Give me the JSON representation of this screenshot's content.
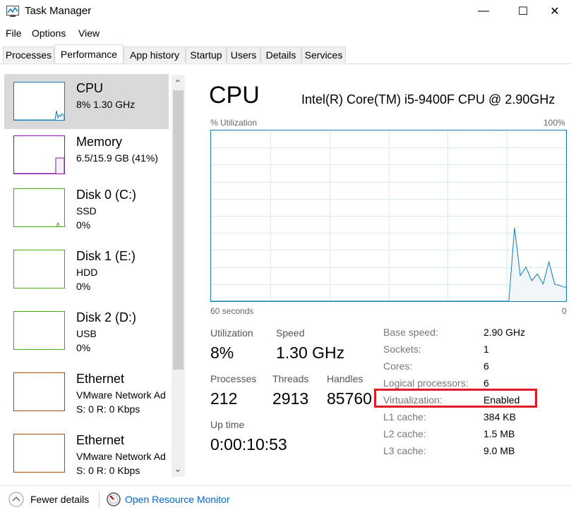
{
  "window": {
    "title": "Task Manager",
    "minimize_glyph": "—",
    "maximize_glyph": "☐",
    "close_glyph": "✕"
  },
  "menu": {
    "file": "File",
    "options": "Options",
    "view": "View"
  },
  "tabs": [
    "Processes",
    "Performance",
    "App history",
    "Startup",
    "Users",
    "Details",
    "Services"
  ],
  "active_tab": "Performance",
  "sidebar": {
    "items": [
      {
        "name": "CPU",
        "line2": "8%  1.30 GHz",
        "line3": "",
        "color": "#117dbb"
      },
      {
        "name": "Memory",
        "line2": "6.5/15.9 GB (41%)",
        "line3": "",
        "color": "#8b12ae"
      },
      {
        "name": "Disk 0 (C:)",
        "line2": "SSD",
        "line3": "0%",
        "color": "#4da60c"
      },
      {
        "name": "Disk 1 (E:)",
        "line2": "HDD",
        "line3": "0%",
        "color": "#4da60c"
      },
      {
        "name": "Disk 2 (D:)",
        "line2": "USB",
        "line3": "0%",
        "color": "#4da60c"
      },
      {
        "name": "Ethernet",
        "line2": "VMware Network Ad",
        "line3": "S: 0  R: 0 Kbps",
        "color": "#a74f01"
      },
      {
        "name": "Ethernet",
        "line2": "VMware Network Ad",
        "line3": "S: 0  R: 0 Kbps",
        "color": "#a74f01"
      }
    ],
    "scroll_up_glyph": "⌃",
    "scroll_down_glyph": "⌄"
  },
  "main": {
    "title": "CPU",
    "model": "Intel(R) Core(TM) i5-9400F CPU @ 2.90GHz",
    "graph_label": "% Utilization",
    "graph_max": "100%",
    "graph_time": "60 seconds",
    "graph_min": "0",
    "graph_color": "#117dbb",
    "graph_fill": "#f1f6fa",
    "graph_grid": "#d9eaf4",
    "utilization_series": [
      0,
      0,
      0,
      0,
      0,
      0,
      0,
      0,
      0,
      0,
      0,
      0,
      0,
      0,
      0,
      0,
      0,
      0,
      0,
      0,
      0,
      0,
      0,
      0,
      0,
      0,
      0,
      0,
      0,
      0,
      0,
      0,
      0,
      0,
      0,
      0,
      0,
      0,
      0,
      0,
      0,
      0,
      0,
      0,
      0,
      0,
      0,
      0,
      0,
      0,
      0,
      0,
      0,
      43,
      15,
      20,
      12,
      16,
      10,
      23,
      10,
      9,
      8
    ],
    "stats": {
      "utilization_label": "Utilization",
      "utilization": "8%",
      "speed_label": "Speed",
      "speed": "1.30 GHz",
      "processes_label": "Processes",
      "processes": "212",
      "threads_label": "Threads",
      "threads": "2913",
      "handles_label": "Handles",
      "handles": "85760",
      "uptime_label": "Up time",
      "uptime": "0:00:10:53"
    },
    "specs": [
      {
        "label": "Base speed:",
        "value": "2.90 GHz"
      },
      {
        "label": "Sockets:",
        "value": "1"
      },
      {
        "label": "Cores:",
        "value": "6"
      },
      {
        "label": "Logical processors:",
        "value": "6"
      },
      {
        "label": "Virtualization:",
        "value": "Enabled"
      },
      {
        "label": "L1 cache:",
        "value": "384 KB"
      },
      {
        "label": "L2 cache:",
        "value": "1.5 MB"
      },
      {
        "label": "L3 cache:",
        "value": "9.0 MB"
      }
    ],
    "highlight_color": "#e01b24"
  },
  "footer": {
    "fewer_details": "Fewer details",
    "open_resource_monitor": "Open Resource Monitor",
    "link_color": "#0066cc"
  }
}
